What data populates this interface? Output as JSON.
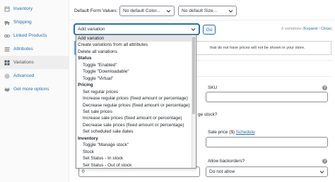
{
  "sidebar": {
    "tabs": [
      {
        "label": "Inventory",
        "icon": "inventory-icon",
        "active": false
      },
      {
        "label": "Shipping",
        "icon": "truck-icon",
        "active": false
      },
      {
        "label": "Linked Products",
        "icon": "link-icon",
        "active": false
      },
      {
        "label": "Attributes",
        "icon": "list-icon",
        "active": false
      },
      {
        "label": "Variations",
        "icon": "grid-icon",
        "active": true
      },
      {
        "label": "Advanced",
        "icon": "gear-icon",
        "active": false
      },
      {
        "label": "Get more options",
        "icon": "plugin-icon",
        "active": false
      }
    ]
  },
  "default_form": {
    "label": "Default Form Values:",
    "color_select": "No default Color...",
    "size_select": "No default Size..."
  },
  "bulk": {
    "selected": "Add variation",
    "go_label": "Go",
    "count_text": "6 variations",
    "expand": "Expand",
    "close": "Close",
    "separator": " / "
  },
  "notice": {
    "text": "that do not have prices will not be shown in your store."
  },
  "dropdown": {
    "options": [
      {
        "label": "Add variation",
        "kind": "g0"
      },
      {
        "label": "Create variations from all attributes",
        "kind": "g0"
      },
      {
        "label": "Delete all variations",
        "kind": "g0"
      },
      {
        "label": "Status",
        "kind": "group"
      },
      {
        "label": "Toggle \"Enabled\"",
        "kind": "g1"
      },
      {
        "label": "Toggle \"Downloadable\"",
        "kind": "g1"
      },
      {
        "label": "Toggle \"Virtual\"",
        "kind": "g1"
      },
      {
        "label": "Pricing",
        "kind": "group"
      },
      {
        "label": "Set regular prices",
        "kind": "g1"
      },
      {
        "label": "Increase regular prices (fixed amount or percentage)",
        "kind": "g1"
      },
      {
        "label": "Decrease regular prices (fixed amount or percentage)",
        "kind": "g1"
      },
      {
        "label": "Set sale prices",
        "kind": "g1"
      },
      {
        "label": "Increase sale prices (fixed amount or percentage)",
        "kind": "g1"
      },
      {
        "label": "Decrease sale prices (fixed amount or percentage)",
        "kind": "g1"
      },
      {
        "label": "Set scheduled sale dates",
        "kind": "g1"
      },
      {
        "label": "Inventory",
        "kind": "group"
      },
      {
        "label": "Toggle \"Manage stock\"",
        "kind": "g1"
      },
      {
        "label": "Stock",
        "kind": "g1"
      },
      {
        "label": "Set Status - In stock",
        "kind": "g1"
      },
      {
        "label": "Set Status - Out of stock",
        "kind": "g1"
      }
    ]
  },
  "variation_form": {
    "sku_label": "SKU",
    "stock_fragment": "ge stock?",
    "sale_price_label": "Sale price ($)",
    "schedule_link": "Schedule",
    "backorders_label": "Allow backorders?",
    "backorders_value": "Do not allow",
    "stock_qty_value": "0"
  },
  "colors": {
    "link": "#2271b1",
    "border": "#8c8f94",
    "active_tab_bg": "#eeeeee"
  }
}
